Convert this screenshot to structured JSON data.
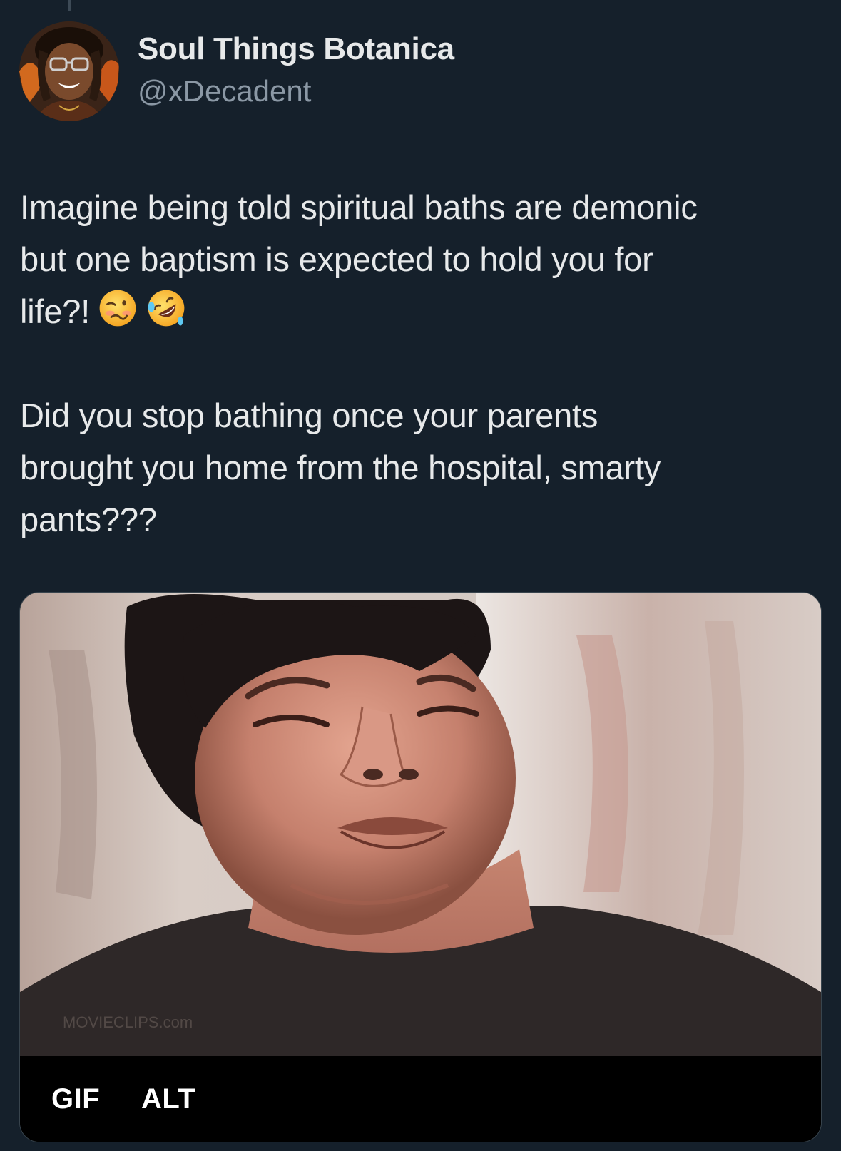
{
  "tweet": {
    "author": {
      "display_name": "Soul Things Botanica",
      "handle": "@xDecadent"
    },
    "paragraphs": [
      "Imagine being told spiritual baths are demonic\nbut one baptism is expected to hold you for\nlife?!",
      "Did you stop bathing once your parents\nbrought you home from the hospital, smarty\npants???"
    ],
    "emojis": [
      "woozy-face",
      "rolling-on-floor-laughing"
    ],
    "media": {
      "type_badge": "GIF",
      "alt_badge": "ALT",
      "watermark": "MOVIECLIPS.com"
    }
  },
  "colors": {
    "background": "#15202b",
    "text_primary": "#e7e9ea",
    "text_secondary": "#8b98a5",
    "border": "#38444d"
  }
}
